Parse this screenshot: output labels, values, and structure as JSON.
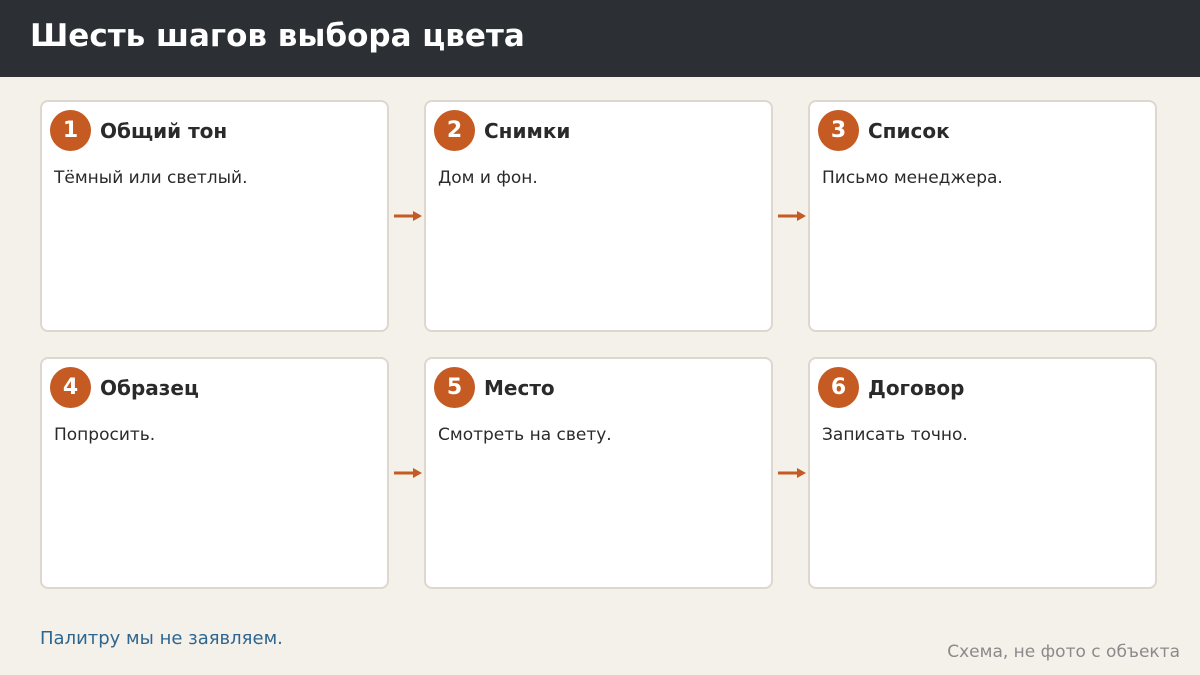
{
  "header": {
    "title": "Шесть шагов выбора цвета"
  },
  "steps": [
    {
      "number": "1",
      "title": "Общий тон",
      "text": "Тёмный или светлый."
    },
    {
      "number": "2",
      "title": "Снимки",
      "text": "Дом и фон."
    },
    {
      "number": "3",
      "title": "Список",
      "text": "Письмо менеджера."
    },
    {
      "number": "4",
      "title": "Образец",
      "text": "Попросить."
    },
    {
      "number": "5",
      "title": "Место",
      "text": "Смотреть на свету."
    },
    {
      "number": "6",
      "title": "Договор",
      "text": "Записать точно."
    }
  ],
  "footer": {
    "note": "Палитру мы не заявляем.",
    "caption": "Схема, не фото с объекта"
  },
  "colors": {
    "accent": "#c55a22",
    "header_bg": "#2c2f33",
    "page_bg": "#f4f1eb",
    "note_link": "#2e6690"
  }
}
